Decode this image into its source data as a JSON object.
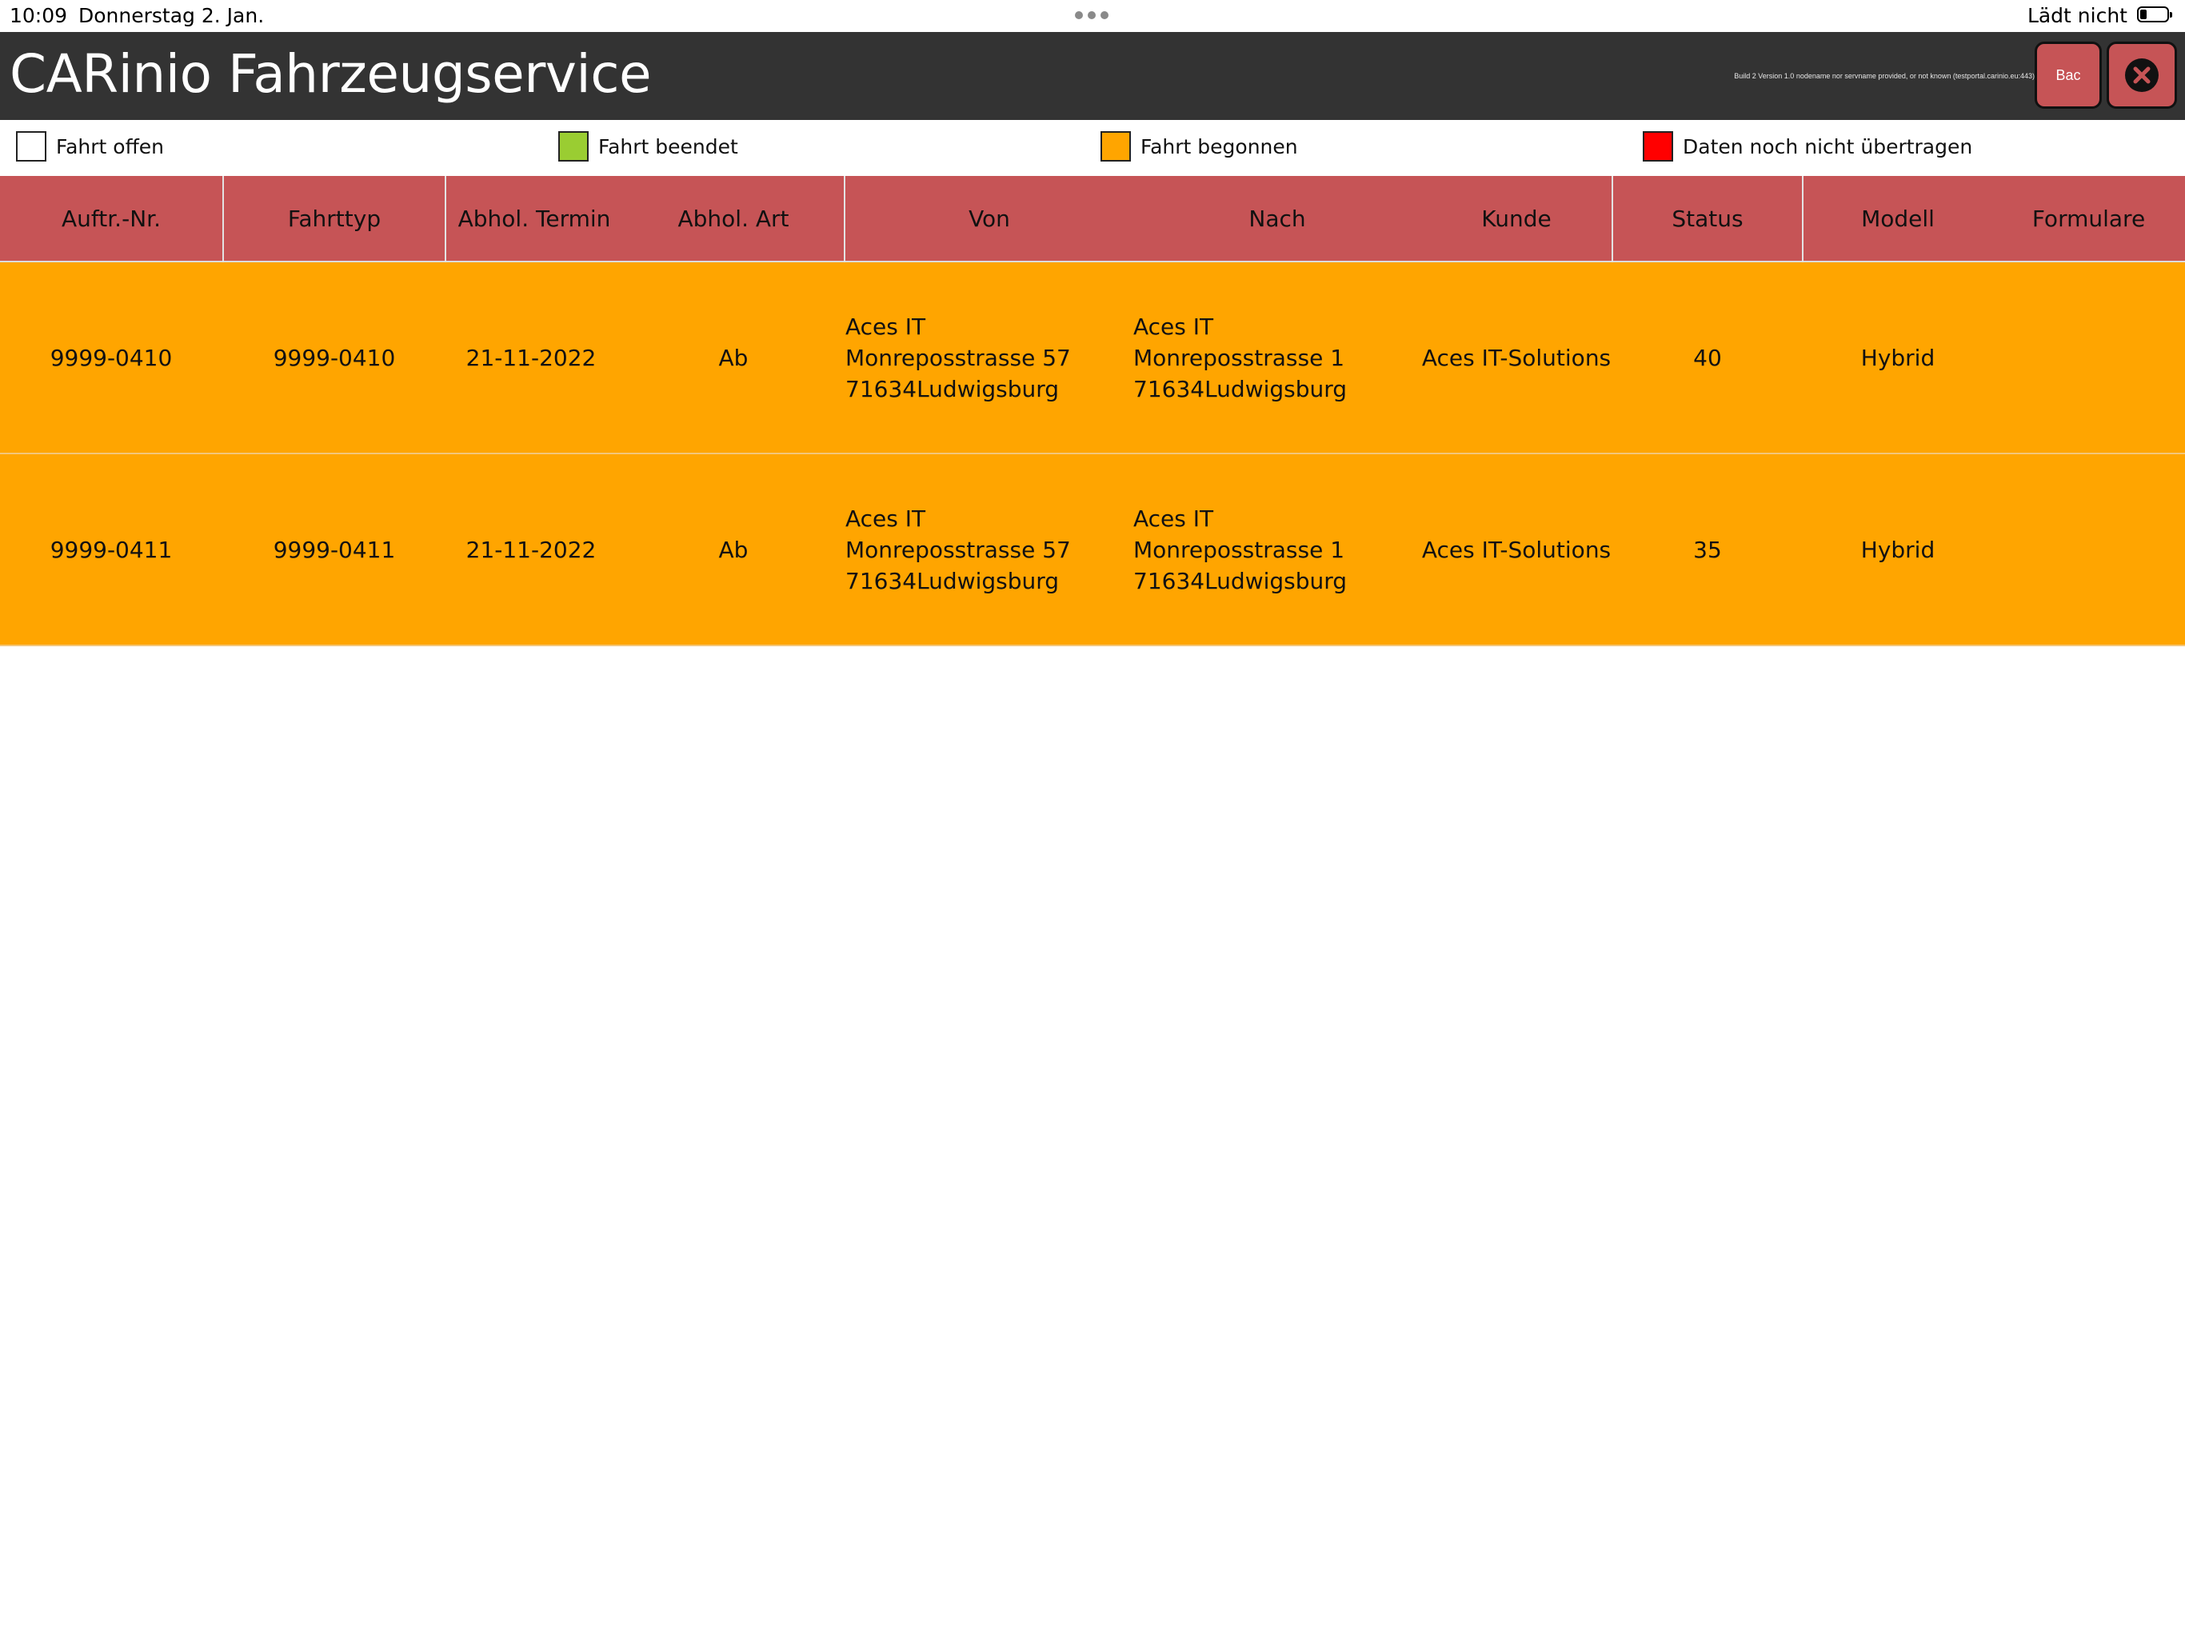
{
  "status_bar": {
    "time": "10:09",
    "date": "Donnerstag 2. Jan.",
    "charging": "Lädt nicht"
  },
  "header": {
    "title": "CARinio Fahrzeugservice",
    "build_info": "Build 2 Version 1.0 nodename nor servname provided, or not known (testportal.carinio.eu:443)",
    "bac_label": "Bac",
    "close_icon": "close-circle-icon"
  },
  "legend": [
    {
      "label": "Fahrt offen",
      "color": "#ffffff"
    },
    {
      "label": "Fahrt beendet",
      "color": "#9acd32"
    },
    {
      "label": "Fahrt begonnen",
      "color": "#ffa500"
    },
    {
      "label": "Daten noch nicht übertragen",
      "color": "#ff0000"
    }
  ],
  "table": {
    "header_color": "#c65456",
    "columns": [
      "Auftr.-Nr.",
      "Fahrttyp",
      "Abhol. Termin",
      "Abhol. Art",
      "Von",
      "Nach",
      "Kunde",
      "Status",
      "Modell",
      "Formulare"
    ],
    "rows": [
      {
        "color": "#ffa500",
        "auftr_nr": "9999-0410",
        "fahrttyp": "9999-0410",
        "abhol_termin": "21-11-2022",
        "abhol_art": "Ab",
        "von": [
          "Aces IT",
          "Monreposstrasse 57",
          "71634Ludwigsburg"
        ],
        "nach": [
          "Aces IT",
          "Monreposstrasse 1",
          "71634Ludwigsburg"
        ],
        "kunde": "Aces IT-Solutions",
        "status": "40",
        "modell": "Hybrid",
        "formulare": ""
      },
      {
        "color": "#ffa500",
        "auftr_nr": "9999-0411",
        "fahrttyp": "9999-0411",
        "abhol_termin": "21-11-2022",
        "abhol_art": "Ab",
        "von": [
          "Aces IT",
          "Monreposstrasse 57",
          "71634Ludwigsburg"
        ],
        "nach": [
          "Aces IT",
          "Monreposstrasse 1",
          "71634Ludwigsburg"
        ],
        "kunde": "Aces IT-Solutions",
        "status": "35",
        "modell": "Hybrid",
        "formulare": ""
      }
    ]
  }
}
